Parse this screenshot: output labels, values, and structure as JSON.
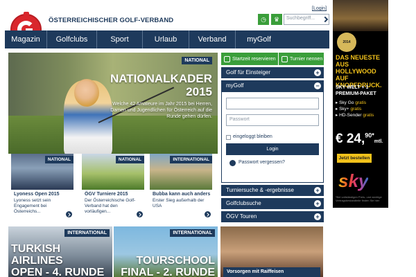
{
  "header": {
    "brand": "ÖSTERREICHISCHER GOLF-VERBAND",
    "login_link": "[Login]",
    "search_placeholder": "Suchbegriff..."
  },
  "nav": {
    "items": [
      "Magazin",
      "Golfclubs",
      "Sport",
      "Urlaub",
      "Verband",
      "myGolf"
    ]
  },
  "hero": {
    "badge": "NATIONAL",
    "title_line1": "NATIONALKADER",
    "title_line2": "2015",
    "text": "Welche 42 Amateure im Jahr 2015 bei Herren, Damen und Jugendlichen für Österreich auf die Runde gehen dürfen."
  },
  "teasers": [
    {
      "badge": "NATIONAL",
      "title": "Lyoness Open 2015",
      "text": "Lyoness setzt sein Engagement bei Österreichs..."
    },
    {
      "badge": "NATIONAL",
      "title": "ÖGV Turniere 2015",
      "text": "Der Österreichische Golf-Verband hat den vorläufigen..."
    },
    {
      "badge": "INTERNATIONAL",
      "title": "Bubba kann auch anders",
      "text": "Erster Sieg außerhalb der USA"
    }
  ],
  "cards": [
    {
      "badge": "INTERNATIONAL",
      "title_line1": "TURKISH AIRLINES",
      "title_line2": "OPEN - 4. RUNDE"
    },
    {
      "badge": "INTERNATIONAL",
      "title_line1": "TOURSCHOOL",
      "title_line2": "FINAL - 2. RUNDE"
    },
    {
      "badge": "",
      "title_line1": "Vorsorgen mit Raiffeisen",
      "title_line2": ""
    }
  ],
  "sidebar": {
    "startzeit_label": "Startzeit reservieren",
    "turnier_label": "Turnier nennen",
    "acc_einsteiger": "Golf für Einsteiger",
    "acc_mygolf": "myGolf",
    "username_placeholder": "",
    "password_placeholder": "Passwort",
    "remember_label": "eingeloggt bleiben",
    "login_button": "Login",
    "forgot_link": "Passwort vergessen?",
    "acc_turniersuche": "Turniersuche & -ergebnisse",
    "acc_golfclubsuche": "Golfclubsuche",
    "acc_oegv_touren": "ÖGV Touren",
    "toggle_plus": "+",
    "toggle_minus": "−"
  },
  "ad": {
    "seal": "2014",
    "headline": "DAS NEUESTE AUS HOLLYWOOD AUF KNOPFDRUCK.",
    "sub": "SKY WELT + 1 PREMIUM-PAKET",
    "item1_prefix": "Sky Go",
    "item1_hl": "gratis",
    "item2_prefix": "Sky+",
    "item2_hl": "gratis",
    "item3_prefix": "HD-Sender",
    "item3_hl": "gratis",
    "price": "€ 24,",
    "price_cents": "90*",
    "price_unit": "mtl.",
    "button": "Jetzt bestellen",
    "logo": "sky",
    "fine": "*Bei vollständigen Preis- und wichtige Vertragsbestandteile finden Sie hier"
  },
  "colors": {
    "brand_navy": "#1e3a5c",
    "brand_red": "#d9262c",
    "action_green": "#3a9e3a",
    "ad_yellow": "#f2c21b"
  },
  "icons": [
    "golf-logo-icon",
    "clock-icon",
    "trophy-icon",
    "search-icon",
    "plus-icon",
    "minus-icon",
    "arrow-right-icon"
  ]
}
